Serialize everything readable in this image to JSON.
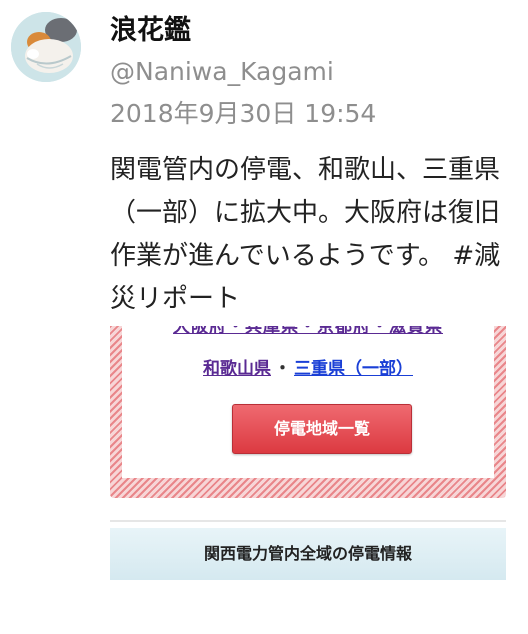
{
  "tweet": {
    "display_name": "浪花鑑",
    "handle": "@Naniwa_Kagami",
    "timestamp": "2018年9月30日 19:54",
    "text": "関電管内の停電、和歌山、三重県（一部）に拡大中。大阪府は復旧作業が進んでいるようです。 #減災リポート"
  },
  "embed": {
    "cutoff_links": "大阪府・兵庫県・京都府・滋賀県",
    "regions": [
      {
        "label": "和歌山県",
        "color": "#5a2a93"
      },
      {
        "label": "三重県（一部）",
        "color": "#1a3fd6"
      }
    ],
    "separator": "・",
    "button_label": "停電地域一覧",
    "button_color": "#dc3a41"
  },
  "footer": {
    "info_label": "関西電力管内全域の停電情報"
  },
  "icons": {
    "avatar": "cat-avatar"
  }
}
